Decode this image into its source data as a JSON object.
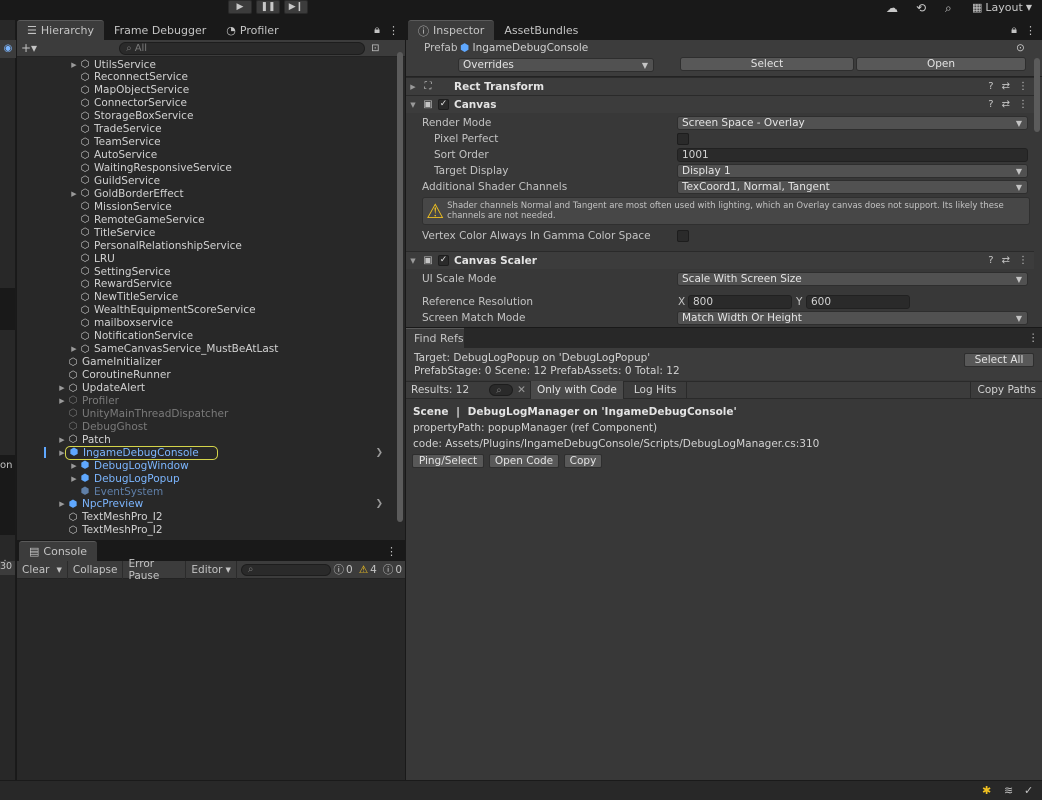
{
  "toolbar": {
    "play_icon": "play-icon",
    "pause_icon": "pause-icon",
    "step_icon": "step-icon",
    "layout_label": "Layout"
  },
  "hierarchy": {
    "tabs": [
      {
        "label": "Hierarchy"
      },
      {
        "label": "Frame Debugger"
      },
      {
        "label": "Profiler"
      }
    ],
    "search_placeholder": "All",
    "items": [
      {
        "label": "UtilsService",
        "indent": 2,
        "fold": true,
        "state": "normal"
      },
      {
        "label": "ReconnectService",
        "indent": 2,
        "fold": false,
        "state": "normal"
      },
      {
        "label": "MapObjectService",
        "indent": 2,
        "fold": false,
        "state": "normal"
      },
      {
        "label": "ConnectorService",
        "indent": 2,
        "fold": false,
        "state": "normal"
      },
      {
        "label": "StorageBoxService",
        "indent": 2,
        "fold": false,
        "state": "normal"
      },
      {
        "label": "TradeService",
        "indent": 2,
        "fold": false,
        "state": "normal"
      },
      {
        "label": "TeamService",
        "indent": 2,
        "fold": false,
        "state": "normal"
      },
      {
        "label": "AutoService",
        "indent": 2,
        "fold": false,
        "state": "normal"
      },
      {
        "label": "WaitingResponsiveService",
        "indent": 2,
        "fold": false,
        "state": "normal"
      },
      {
        "label": "GuildService",
        "indent": 2,
        "fold": false,
        "state": "normal"
      },
      {
        "label": "GoldBorderEffect",
        "indent": 2,
        "fold": true,
        "state": "normal"
      },
      {
        "label": "MissionService",
        "indent": 2,
        "fold": false,
        "state": "normal"
      },
      {
        "label": "RemoteGameService",
        "indent": 2,
        "fold": false,
        "state": "normal"
      },
      {
        "label": "TitleService",
        "indent": 2,
        "fold": false,
        "state": "normal"
      },
      {
        "label": "PersonalRelationshipService",
        "indent": 2,
        "fold": false,
        "state": "normal"
      },
      {
        "label": "LRU",
        "indent": 2,
        "fold": false,
        "state": "normal"
      },
      {
        "label": "SettingService",
        "indent": 2,
        "fold": false,
        "state": "normal"
      },
      {
        "label": "RewardService",
        "indent": 2,
        "fold": false,
        "state": "normal"
      },
      {
        "label": "NewTitleService",
        "indent": 2,
        "fold": false,
        "state": "normal"
      },
      {
        "label": "WealthEquipmentScoreService",
        "indent": 2,
        "fold": false,
        "state": "normal"
      },
      {
        "label": "mailboxservice",
        "indent": 2,
        "fold": false,
        "state": "normal"
      },
      {
        "label": "NotificationService",
        "indent": 2,
        "fold": false,
        "state": "normal"
      },
      {
        "label": "SameCanvasService_MustBeAtLast",
        "indent": 2,
        "fold": true,
        "state": "normal"
      },
      {
        "label": "GameInitializer",
        "indent": 1,
        "fold": false,
        "state": "normal"
      },
      {
        "label": "CoroutineRunner",
        "indent": 1,
        "fold": false,
        "state": "normal"
      },
      {
        "label": "UpdateAlert",
        "indent": 1,
        "fold": true,
        "state": "normal"
      },
      {
        "label": "Profiler",
        "indent": 1,
        "fold": true,
        "state": "disabled"
      },
      {
        "label": "UnityMainThreadDispatcher",
        "indent": 1,
        "fold": false,
        "state": "disabled"
      },
      {
        "label": "DebugGhost",
        "indent": 1,
        "fold": false,
        "state": "disabled"
      },
      {
        "label": "Patch",
        "indent": 1,
        "fold": true,
        "state": "normal"
      },
      {
        "label": "IngameDebugConsole",
        "indent": 1,
        "fold": true,
        "state": "prefab-selected"
      },
      {
        "label": "DebugLogWindow",
        "indent": 2,
        "fold": true,
        "state": "prefab"
      },
      {
        "label": "DebugLogPopup",
        "indent": 2,
        "fold": true,
        "state": "prefab"
      },
      {
        "label": "EventSystem",
        "indent": 2,
        "fold": false,
        "state": "prefab-disabled"
      },
      {
        "label": "NpcPreview",
        "indent": 1,
        "fold": true,
        "state": "prefab-arrow"
      },
      {
        "label": "TextMeshPro_I2",
        "indent": 1,
        "fold": false,
        "state": "normal"
      },
      {
        "label": "TextMeshPro_I2",
        "indent": 1,
        "fold": false,
        "state": "normal"
      }
    ]
  },
  "console": {
    "tab_label": "Console",
    "clear_label": "Clear",
    "collapse_label": "Collapse",
    "error_pause_label": "Error Pause",
    "editor_label": "Editor",
    "info_count": "0",
    "warning_count": "4",
    "error_count": "0",
    "left_count": "30"
  },
  "inspector": {
    "tabs": [
      {
        "label": "Inspector"
      },
      {
        "label": "AssetBundles"
      }
    ],
    "prefab_label": "Prefab",
    "prefab_name": "IngameDebugConsole",
    "overrides_label": "Overrides",
    "select_label": "Select",
    "open_label": "Open",
    "rect_transform_label": "Rect Transform",
    "canvas": {
      "title": "Canvas",
      "render_mode_label": "Render Mode",
      "render_mode_value": "Screen Space - Overlay",
      "pixel_perfect_label": "Pixel Perfect",
      "sort_order_label": "Sort Order",
      "sort_order_value": "1001",
      "target_display_label": "Target Display",
      "target_display_value": "Display 1",
      "shader_channels_label": "Additional Shader Channels",
      "shader_channels_value": "TexCoord1, Normal, Tangent",
      "warning_text": "Shader channels Normal and Tangent are most often used with lighting, which an Overlay canvas does not support. Its likely these channels are not needed.",
      "vertex_color_label": "Vertex Color Always In Gamma Color Space"
    },
    "canvas_scaler": {
      "title": "Canvas Scaler",
      "ui_scale_mode_label": "UI Scale Mode",
      "ui_scale_mode_value": "Scale With Screen Size",
      "ref_resolution_label": "Reference Resolution",
      "x_label": "X",
      "x_value": "800",
      "y_label": "Y",
      "y_value": "600",
      "screen_match_label": "Screen Match Mode",
      "screen_match_value": "Match Width Or Height"
    }
  },
  "find_refs": {
    "tab_label": "Find Refs",
    "target_line": "Target: DebugLogPopup on 'DebugLogPopup'",
    "stats_line": "PrefabStage: 0   Scene: 12   PrefabAssets: 0   Total: 12",
    "select_all_label": "Select All",
    "results_label": "Results: 12",
    "only_with_code_label": "Only with Code",
    "log_hits_label": "Log Hits",
    "copy_paths_label": "Copy Paths",
    "result": {
      "scene_label": "Scene",
      "heading": "DebugLogManager on 'IngameDebugConsole'",
      "property_path": "propertyPath: popupManager   (ref Component)",
      "code_path": "code: Assets/Plugins/IngameDebugConsole/Scripts/DebugLogManager.cs:310",
      "ping_label": "Ping/Select",
      "open_code_label": "Open Code",
      "copy_label": "Copy"
    }
  },
  "colors": {
    "prefab_blue": "#7cb6ff",
    "selection_outline": "#d4d44a",
    "warning_yellow": "#f0c020"
  }
}
